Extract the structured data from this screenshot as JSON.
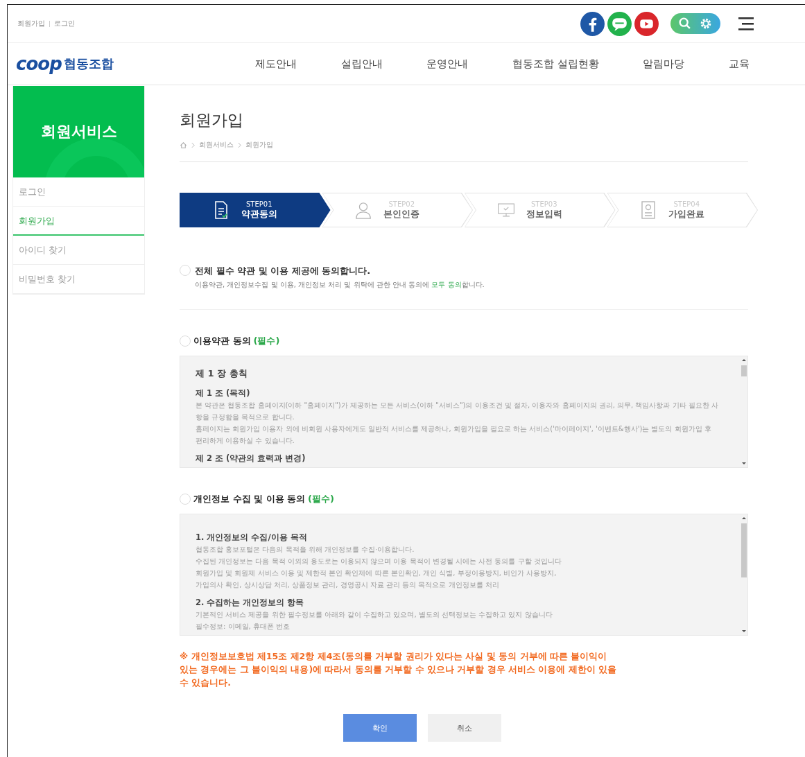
{
  "top_links": [
    "회원가입",
    "로그인"
  ],
  "social": [
    {
      "kind": "facebook"
    },
    {
      "kind": "talk"
    },
    {
      "kind": "youtube"
    }
  ],
  "logo": {
    "mark": "coop",
    "name": "협동조합"
  },
  "nav": [
    "제도안내",
    "설립안내",
    "운영안내",
    "협동조합 설립현황",
    "알림마당",
    "교육"
  ],
  "sidebar": {
    "title": "회원서비스",
    "items": [
      {
        "label": "로그인",
        "selected": false
      },
      {
        "label": "회원가입",
        "selected": true
      },
      {
        "label": "아이디 찾기",
        "selected": false
      },
      {
        "label": "비밀번호 찾기",
        "selected": false
      }
    ]
  },
  "page_title": "회원가입",
  "breadcrumb": [
    "회원서비스",
    "회원가입"
  ],
  "steps": [
    {
      "kind": "document",
      "step": "STEP01",
      "label": "약관동의",
      "selected": true
    },
    {
      "kind": "person",
      "step": "STEP02",
      "label": "본인인증",
      "selected": false
    },
    {
      "kind": "monitor",
      "step": "STEP03",
      "label": "정보입력",
      "selected": false
    },
    {
      "kind": "card",
      "step": "STEP04",
      "label": "가입완료",
      "selected": false
    }
  ],
  "agree_all": {
    "label": "전체 필수 약관 및 이용 제공에 동의합니다.",
    "note": "이용약관, 개인정보수집 및 이용, 개인정보 처리 및 위탁에 관한 안내 동의에 **모두 동의**합니다.",
    "checked": false
  },
  "sections": [
    {
      "label": "이용약관 동의",
      "required": "(필수)",
      "checked": false,
      "blocks": [
        {
          "kind": "chapter",
          "text": "제 1 장 총칙"
        },
        {
          "kind": "heading",
          "text": "제 1 조 (목적)"
        },
        {
          "kind": "para",
          "text": "본 약관은 협동조합 홈페이지(이하 \"홈페이지\")가 제공하는 모든 서비스(이하 \"서비스\")의 이용조건 및 절차, 이용자와 홈페이지의 권리, 의무, 책임사항과 기타 필요한 사항을 규정함을 목적으로 합니다."
        },
        {
          "kind": "para",
          "text": "홈페이지는 회원가입 이용자 외에 비회원 사용자에게도 일반적 서비스를 제공하나, 회원가입을 필요로 하는 서비스('마이페이지', '이벤트&행사')는 별도의 회원가입 후 편리하게 이용하실 수 있습니다."
        },
        {
          "kind": "heading",
          "text": "제 2 조 (약관의 효력과 변경)"
        }
      ]
    },
    {
      "label": "개인정보 수집 및 이용 동의",
      "required": "(필수)",
      "checked": false,
      "blocks": [
        {
          "kind": "heading",
          "text": "1. 개인정보의 수집/이용 목적"
        },
        {
          "kind": "para",
          "text": "협동조합 홍보포털은 다음의 목적을 위해 개인정보를 수집·이용합니다."
        },
        {
          "kind": "para",
          "text": "수집된 개인정보는 다음 목적 이외의 용도로는 이용되지 않으며 이용 목적이 변경될 시에는 사전 동의를 구할 것입니다"
        },
        {
          "kind": "para",
          "text": "회원가입 및 회원제 서비스 이용 및 제한적 본인 확인제에 따른 본인확인, 개인 식별, 부정이용방지, 비인가 사용방지,"
        },
        {
          "kind": "para",
          "text": "가입의사 확인, 상시상담 처리, 상품정보 관리, 경영공시 자료 관리 등의 목적으로 개인정보를 처리"
        },
        {
          "kind": "heading",
          "text": "2. 수집하는 개인정보의 항목"
        },
        {
          "kind": "para",
          "text": "기본적인 서비스 제공을 위한 필수정보를 아래와 같이 수집하고 있으며, 별도의 선택정보는 수집하고 있지 않습니다"
        },
        {
          "kind": "para",
          "text": "필수정보: 이메일, 휴대폰 번호"
        }
      ]
    }
  ],
  "notice": "※ 개인정보보호법 제15조 제2항 제4조(동의를 거부할 권리가 있다는 사실 및 동의 거부에 따른 불이익이 있는 경우에는 그 불이익의 내용)에 따라서 동의를 거부할 수 있으나 거부할 경우 서비스 이용에 제한이 있을 수 있습니다.",
  "buttons": [
    {
      "kind": "primary",
      "label": "확인"
    },
    {
      "kind": "secondary",
      "label": "취소"
    }
  ]
}
